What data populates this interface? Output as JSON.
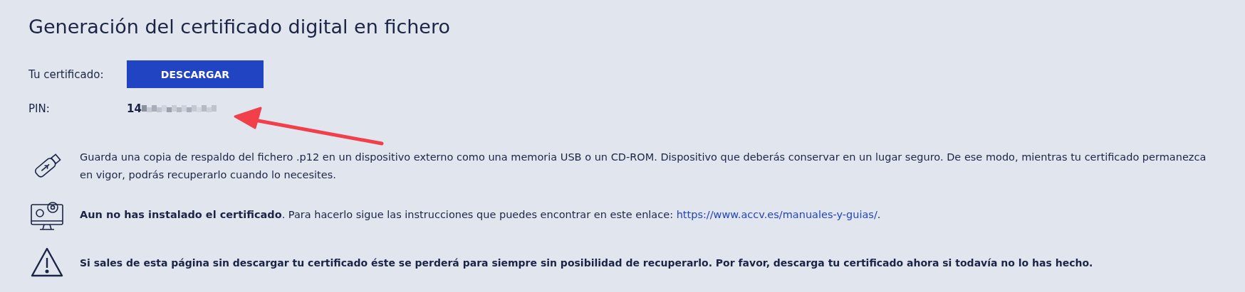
{
  "title": "Generación del certificado digital en fichero",
  "certificate": {
    "label": "Tu certificado:",
    "button": "DESCARGAR"
  },
  "pin": {
    "label": "PIN:",
    "visible_digits": "14"
  },
  "notices": [
    {
      "kind": "usb",
      "bold": false,
      "text": "Guarda una copia de respaldo del fichero .p12 en un dispositivo externo como una memoria USB o un CD-ROM. Dispositivo que deberás conservar en un lugar seguro. De ese modo, mientras tu certificado permanezca en vigor, podrás recuperarlo cuando lo necesites."
    },
    {
      "kind": "monitor",
      "bold": false,
      "text": "**Aun no has instalado el certificado**. Para hacerlo sigue las instrucciones que puedes encontrar en este enlace: ",
      "link": "https://www.accv.es/manuales-y-guias/",
      "text_after": "."
    },
    {
      "kind": "warning",
      "bold": true,
      "text": "Si sales de esta página sin descargar tu certificado éste se perderá para siempre sin posibilidad de recuperarlo. Por favor, descarga tu certificado ahora si todavía no lo has hecho."
    }
  ]
}
